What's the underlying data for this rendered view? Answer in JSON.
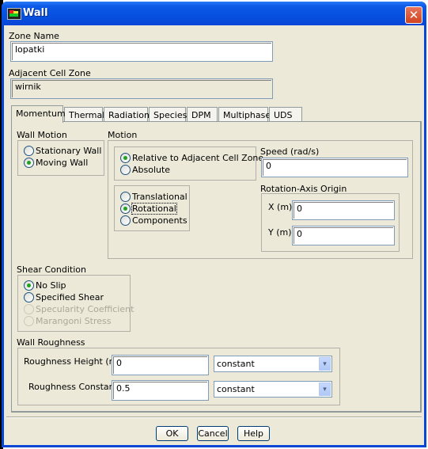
{
  "window": {
    "title": "Wall",
    "close_label": "✕"
  },
  "zone_name": {
    "label": "Zone Name",
    "value": "lopatki"
  },
  "adjacent_cell_zone": {
    "label": "Adjacent Cell Zone",
    "value": "wirnik"
  },
  "tabs": [
    {
      "label": "Momentum",
      "active": true
    },
    {
      "label": "Thermal"
    },
    {
      "label": "Radiation"
    },
    {
      "label": "Species"
    },
    {
      "label": "DPM"
    },
    {
      "label": "Multiphase"
    },
    {
      "label": "UDS"
    }
  ],
  "wall_motion": {
    "title": "Wall Motion",
    "options": [
      {
        "label": "Stationary Wall",
        "selected": false
      },
      {
        "label": "Moving Wall",
        "selected": true
      }
    ]
  },
  "motion": {
    "title": "Motion",
    "reference": [
      {
        "label": "Relative to Adjacent Cell Zone",
        "selected": true
      },
      {
        "label": "Absolute",
        "selected": false
      }
    ],
    "type": [
      {
        "label": "Translational",
        "selected": false
      },
      {
        "label": "Rotational",
        "selected": true
      },
      {
        "label": "Components",
        "selected": false
      }
    ],
    "speed": {
      "label": "Speed (rad/s)",
      "value": "0"
    },
    "rotation_axis_origin": {
      "title": "Rotation-Axis Origin",
      "x": {
        "label": "X (m)",
        "value": "0"
      },
      "y": {
        "label": "Y (m)",
        "value": "0"
      }
    }
  },
  "shear_condition": {
    "title": "Shear Condition",
    "options": [
      {
        "label": "No Slip",
        "selected": true,
        "disabled": false
      },
      {
        "label": "Specified Shear",
        "selected": false,
        "disabled": false
      },
      {
        "label": "Specularity Coefficient",
        "selected": false,
        "disabled": true
      },
      {
        "label": "Marangoni Stress",
        "selected": false,
        "disabled": true
      }
    ]
  },
  "wall_roughness": {
    "title": "Wall Roughness",
    "height": {
      "label": "Roughness Height (m)",
      "value": "0",
      "method": "constant"
    },
    "constant": {
      "label": "Roughness Constant",
      "value": "0.5",
      "method": "constant"
    }
  },
  "buttons": {
    "ok": "OK",
    "cancel": "Cancel",
    "help": "Help"
  },
  "icons": {
    "dropdown": "▾"
  }
}
